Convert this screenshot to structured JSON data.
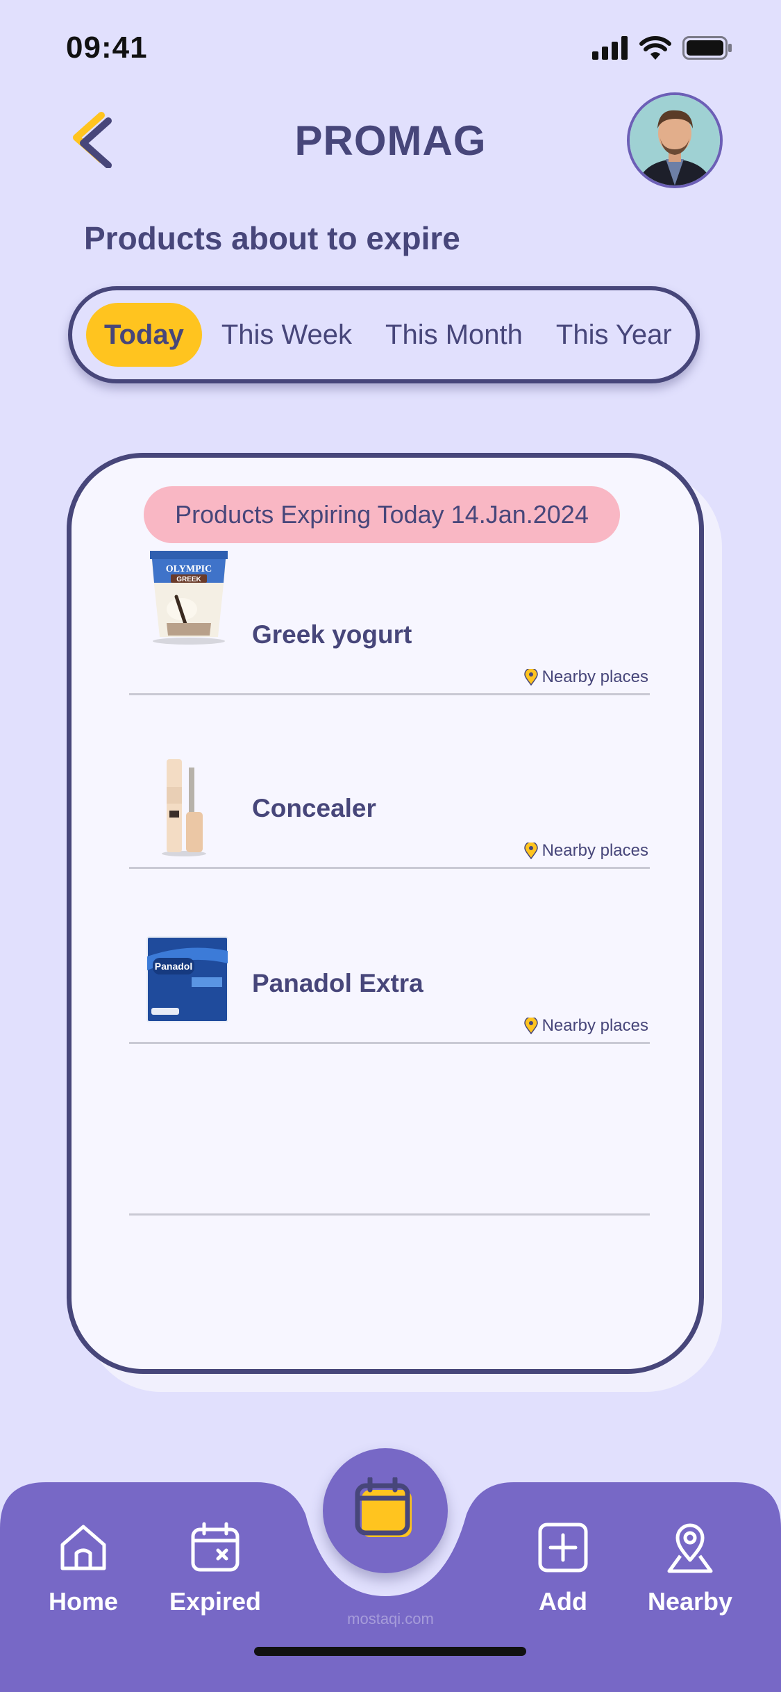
{
  "status_bar": {
    "time": "09:41"
  },
  "header": {
    "title": "PROMAG"
  },
  "section_title": "Products about to expire",
  "tabs": [
    {
      "label": "Today",
      "active": true
    },
    {
      "label": "This Week",
      "active": false
    },
    {
      "label": "This Month",
      "active": false
    },
    {
      "label": "This Year",
      "active": false
    }
  ],
  "card": {
    "date_label": "Products Expiring Today 14.Jan.2024",
    "products": [
      {
        "name": "Greek yogurt",
        "nearby_label": "Nearby places",
        "image_text": "OLYMPIC",
        "image_subtext": "GREEK"
      },
      {
        "name": "Concealer",
        "nearby_label": "Nearby places"
      },
      {
        "name": "Panadol Extra",
        "nearby_label": "Nearby places",
        "image_text": "Panadol"
      }
    ]
  },
  "bottom_nav": {
    "items": [
      {
        "label": "Home",
        "icon": "home-icon"
      },
      {
        "label": "Expired",
        "icon": "calendar-x-icon"
      },
      {
        "label": "Add",
        "icon": "plus-square-icon"
      },
      {
        "label": "Nearby",
        "icon": "location-pin-icon"
      }
    ],
    "center_icon": "calendar-icon"
  },
  "watermark": "mostaqi.com",
  "colors": {
    "background": "#e1e0fd",
    "primary_dark": "#47467a",
    "accent_yellow": "#ffc41f",
    "pill_pink": "#f9b7c4",
    "nav_purple": "#7768c6"
  }
}
